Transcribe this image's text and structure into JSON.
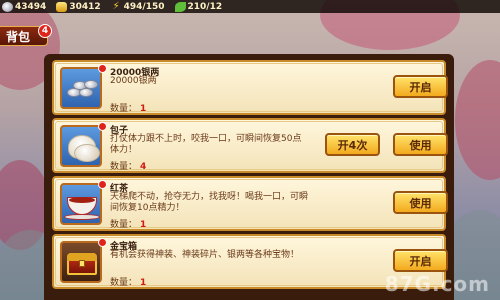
{
  "resources": {
    "silver": "43494",
    "gold": "30412",
    "energy": "494/150",
    "stamina": "210/12"
  },
  "bag": {
    "title": "背包",
    "count": "4"
  },
  "items": [
    {
      "name": "20000银两",
      "desc": "20000银两",
      "qty_label": "数量：",
      "qty": "1",
      "icon": "silver-ingots-icon",
      "buttons": [
        "开启"
      ]
    },
    {
      "name": "包子",
      "desc": "打仗体力跟不上时，咬我一口，可瞬间恢复50点体力！",
      "qty_label": "数量：",
      "qty": "4",
      "icon": "steamed-bun-icon",
      "buttons": [
        "开4次",
        "使用"
      ]
    },
    {
      "name": "红茶",
      "desc": "天梯爬不动，抢夺无力，找我呀！喝我一口，可瞬间恢复10点精力！",
      "qty_label": "数量：",
      "qty": "1",
      "icon": "red-tea-icon",
      "buttons": [
        "使用"
      ]
    },
    {
      "name": "金宝箱",
      "desc": "有机会获得神装、神装碎片、银两等各种宝物！",
      "qty_label": "数量：",
      "qty": "1",
      "icon": "treasure-chest-icon",
      "buttons": [
        "开启"
      ]
    }
  ],
  "watermark": "87G.com"
}
